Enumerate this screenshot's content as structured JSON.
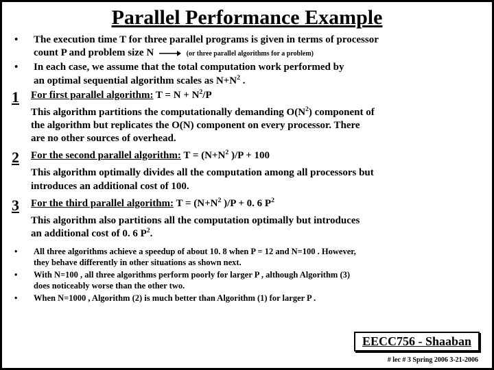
{
  "title": "Parallel Performance Example",
  "bullets": {
    "intro1a": "The execution time T for three parallel programs is given in terms of processor",
    "intro1b": "count  P and problem size  N",
    "intro1_note": "(or three parallel algorithms for a problem)",
    "intro2a": "In each case, we assume that the total computation work performed by",
    "intro2b": "an optimal sequential algorithm scales  as  N+N",
    "intro2c": " ."
  },
  "algs": {
    "n1": "1",
    "a1_lead": "For first parallel algorithm:",
    "a1_eq": "     T =   N + N",
    "a1_tail": "/P",
    "a1_body1": "This algorithm partitions the computationally demanding O(N",
    "a1_body1b": ") component of",
    "a1_body2": "the algorithm but replicates the  O(N) component on every processor.   There",
    "a1_body3": "are no other sources of overhead.",
    "n2": "2",
    "a2_lead": "For the second parallel algorithm:",
    "a2_eq": "   T  =   (N+N",
    "a2_tail": " )/P  +  100",
    "a2_body1": "This algorithm optimally divides all the computation among all processors but",
    "a2_body2": "introduces an additional cost of 100.",
    "n3": "3",
    "a3_lead": "For the third parallel algorithm:",
    "a3_eq": "    T   =   (N+N",
    "a3_mid": " )/P    +    0. 6 P",
    "a3_body1": "This algorithm also partitions all the computation optimally but introduces",
    "a3_body2a": "an additional cost of 0. 6 P",
    "a3_body2b": "."
  },
  "conclusions": {
    "c1a": "All three algorithms achieve a speedup of about 10. 8  when  P = 12 and N=100 .  However,",
    "c1b": "they behave differently in other situations as shown next.",
    "c2a": "With N=100 , all three algorithms perform poorly for larger P , although Algorithm (3)",
    "c2b": "does noticeably worse than the other two.",
    "c3": "When N=1000 , Algorithm (2) is much better than Algorithm (1) for larger P ."
  },
  "footer": {
    "course": "EECC756 - Shaaban",
    "line": "#  lec # 3   Spring 2006   3-21-2006"
  }
}
